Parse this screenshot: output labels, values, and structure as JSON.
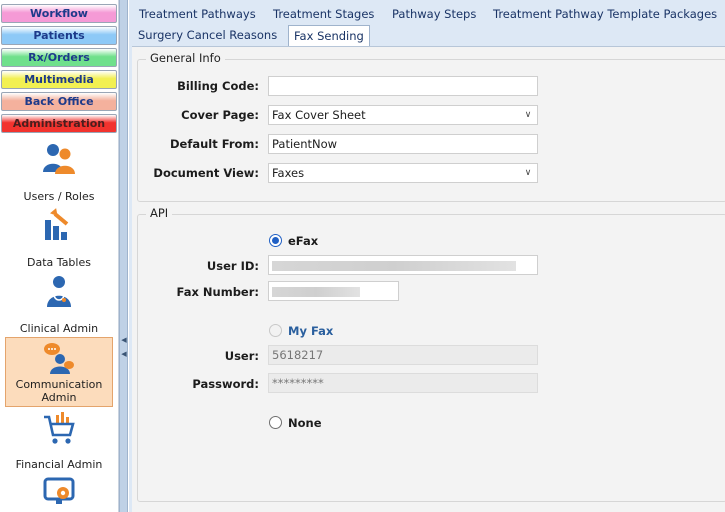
{
  "nav": {
    "modules": [
      {
        "label": "Workflow",
        "color": "#f59ad6"
      },
      {
        "label": "Patients",
        "color": "#8dc9f7"
      },
      {
        "label": "Rx/Orders",
        "color": "#6fe08b"
      },
      {
        "label": "Multimedia",
        "color": "#f2f052"
      },
      {
        "label": "Back Office",
        "color": "#f4b19d"
      },
      {
        "label": "Administration",
        "color": "#f2332e"
      }
    ],
    "tiles": [
      {
        "label": "Users / Roles",
        "icon": "users-roles-icon"
      },
      {
        "label": "Data Tables",
        "icon": "data-tables-icon"
      },
      {
        "label": "Clinical Admin",
        "icon": "clinical-admin-icon"
      },
      {
        "label": "Communication Admin",
        "icon": "communication-admin-icon",
        "active": true
      },
      {
        "label": "Financial Admin",
        "icon": "financial-admin-icon"
      },
      {
        "label": "",
        "icon": "settings-monitor-icon"
      }
    ]
  },
  "tabs": {
    "row1": [
      "Treatment Pathways",
      "Treatment Stages",
      "Pathway Steps",
      "Treatment Pathway Template Packages"
    ],
    "row2": [
      "Surgery Cancel Reasons",
      "Fax Sending"
    ],
    "active": "Fax Sending"
  },
  "general_info": {
    "legend": "General Info",
    "billing_code": {
      "label": "Billing Code:",
      "value": ""
    },
    "cover_page": {
      "label": "Cover Page:",
      "value": "Fax Cover Sheet"
    },
    "default_from": {
      "label": "Default From:",
      "value": "PatientNow"
    },
    "document_view": {
      "label": "Document View:",
      "value": "Faxes"
    }
  },
  "api": {
    "legend": "API",
    "efax": {
      "label": "eFax",
      "selected": true
    },
    "user_id": {
      "label": "User ID:"
    },
    "fax_number": {
      "label": "Fax Number:"
    },
    "myfax": {
      "label": "My Fax",
      "selected": false
    },
    "user": {
      "label": "User:",
      "value": "5618217"
    },
    "password": {
      "label": "Password:",
      "value": "*********"
    },
    "none": {
      "label": "None",
      "selected": false
    }
  }
}
